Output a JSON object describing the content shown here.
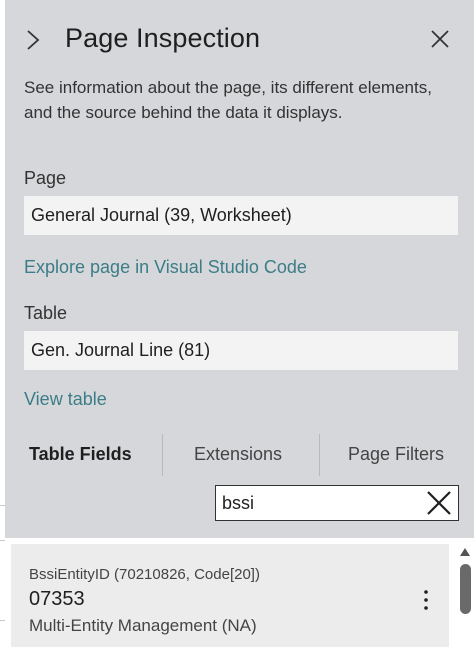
{
  "panel": {
    "title": "Page Inspection",
    "description": "See information about the page, its different elements, and the source behind the data it displays."
  },
  "page_section": {
    "label": "Page",
    "value": "General Journal (39, Worksheet)",
    "link": "Explore page in Visual Studio Code"
  },
  "table_section": {
    "label": "Table",
    "value": "Gen. Journal Line (81)",
    "link": "View table"
  },
  "tabs": [
    {
      "label": "Table Fields",
      "active": true
    },
    {
      "label": "Extensions",
      "active": false
    },
    {
      "label": "Page Filters",
      "active": false
    }
  ],
  "search": {
    "value": "bssi"
  },
  "fields": [
    {
      "name": "BssiEntityID (70210826, Code[20])",
      "value": "07353",
      "source": "Multi-Entity Management (NA)"
    }
  ],
  "icons": {
    "expand": "chevron-right-icon",
    "close": "close-icon",
    "clear": "clear-search-icon",
    "more": "more-options-icon"
  },
  "colors": {
    "panel_background": "#d6d7da",
    "link": "#3c7d87",
    "card_background": "#ececed"
  }
}
